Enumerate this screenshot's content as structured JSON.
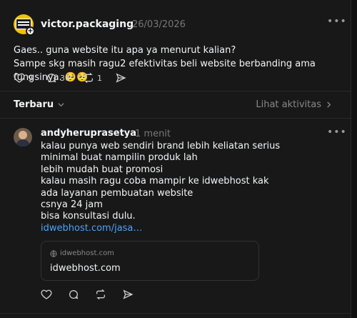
{
  "post": {
    "username": "victor.packaging",
    "date": "26/03/2026",
    "lines": [
      "Gaes.. guna website itu apa ya menurut kalian?",
      "Sampe skg masih ragu2 efektivitas beli website berbanding ama fungsinya. 🥺🥺"
    ],
    "likes": "9",
    "replies": "36",
    "reposts": "1",
    "avatar_icon": "victor-packaging-logo",
    "avatar_color": "#f2c200"
  },
  "filter": {
    "sort_label": "Terbaru",
    "activity_label": "Lihat aktivitas"
  },
  "reply": {
    "username": "andyheruprasetya",
    "time": "1 menit",
    "lines": [
      "kalau punya web sendiri brand lebih keliatan serius",
      "minimal buat nampilin produk lah",
      "lebih mudah buat promosi",
      "kalau masih ragu coba mampir ke idwebhost kak",
      "ada layanan pembuatan website",
      "csnya 24 jam",
      "bisa konsultasi dulu."
    ],
    "link_text": "idwebhost.com/jasa…",
    "link_color": "#4aa3ff",
    "card": {
      "domain": "idwebhost.com",
      "title": "idwebhost.com"
    }
  },
  "icons": [
    "heart-icon",
    "comment-icon",
    "repost-icon",
    "share-icon",
    "more-icon",
    "chevron-down-icon",
    "chevron-right-icon",
    "globe-icon"
  ]
}
